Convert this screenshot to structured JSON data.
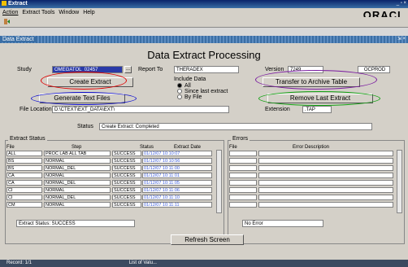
{
  "window": {
    "title": "Extract",
    "controls": "_ ▫ ×"
  },
  "menu": {
    "items": [
      "Action",
      "Extract Tools",
      "Window",
      "Help"
    ],
    "brand": "ORACL"
  },
  "inner_window": {
    "title": "Data Extract",
    "controls": "⇲ ×"
  },
  "form": {
    "title": "Data Extract Processing",
    "study_label": "Study",
    "study_value": "OMEGATOL_02457",
    "lov_button": "...",
    "report_to_label": "Report To",
    "report_to_value": "THERADEX",
    "version_label": "Version",
    "version_value": "7249",
    "env_badge": "OCPROD",
    "include_data_label": "Include Data",
    "include_options": [
      "All",
      "Since last extract",
      "By File"
    ],
    "include_selected": "All",
    "file_location_label": "File Location",
    "file_location_value": "D:\\CTEXT\\EXT_DATA\\EXT\\",
    "extension_label": "Extension",
    "extension_value": ".TAP",
    "status_label": "Status",
    "status_value": "Create Extract: Completed"
  },
  "buttons": {
    "create_extract": "Create Extract",
    "generate_text_files": "Generate Text Files",
    "transfer_to_archive": "Transfer to Archive Table",
    "remove_last_extract": "Remove Last Extract",
    "refresh_screen": "Refresh Screen"
  },
  "highlight_colors": {
    "create_extract": "#e00000",
    "generate_text_files": "#1010d0",
    "transfer_to_archive": "#7a1aa0",
    "remove_last_extract": "#10a010"
  },
  "extract_status": {
    "title": "Extract Status",
    "columns": [
      "File",
      "Step",
      "Status",
      "Extract Date"
    ],
    "rows": [
      {
        "file": "ALL",
        "step": "PROC LAB ALL TAB",
        "status": "SUCCESS",
        "date": "01/12/07 10:10:07"
      },
      {
        "file": "BS",
        "step": "NORMAL",
        "status": "SUCCESS",
        "date": "01/12/07 10:10:56"
      },
      {
        "file": "BS",
        "step": "NORMAL_DEL",
        "status": "SUCCESS",
        "date": "01/12/07 10:11:00"
      },
      {
        "file": "CA",
        "step": "NORMAL",
        "status": "SUCCESS",
        "date": "01/12/07 10:11:01"
      },
      {
        "file": "CA",
        "step": "NORMAL_DEL",
        "status": "SUCCESS",
        "date": "01/12/07 10:11:05"
      },
      {
        "file": "CI",
        "step": "NORMAL",
        "status": "SUCCESS",
        "date": "01/12/07 10:11:06"
      },
      {
        "file": "CI",
        "step": "NORMAL_DEL",
        "status": "SUCCESS",
        "date": "01/12/07 10:11:10"
      },
      {
        "file": "CM",
        "step": "NORMAL",
        "status": "SUCCESS",
        "date": "01/12/07 10:11:11"
      }
    ],
    "summary": "Extract Status: SUCCESS"
  },
  "errors": {
    "title": "Errors",
    "columns": [
      "File",
      "Error Description"
    ],
    "summary": "No Error"
  },
  "statusbar": {
    "record": "Record: 1/1",
    "lov_hint": "List of Valu..."
  }
}
